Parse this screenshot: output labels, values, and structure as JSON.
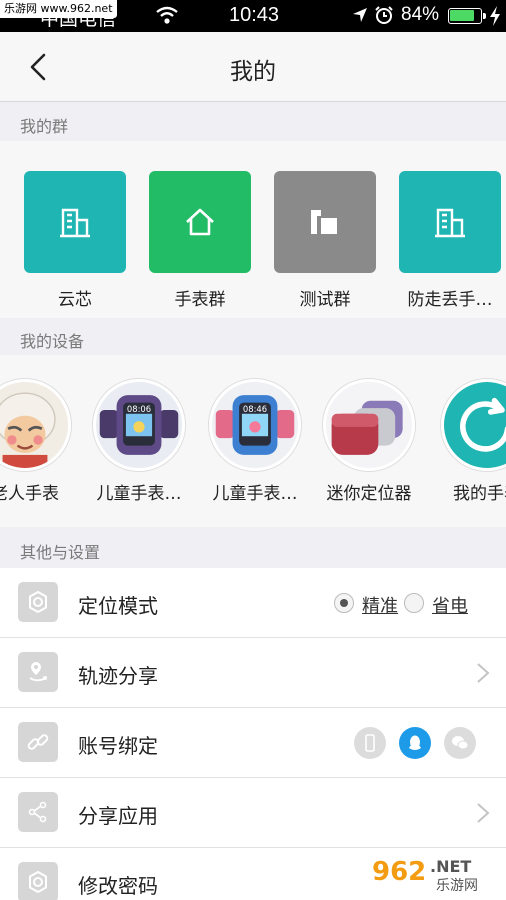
{
  "status_bar": {
    "watermark": "乐游网 www.962.net",
    "carrier": "中国电信",
    "time": "10:43",
    "battery_percent": "84%",
    "battery_level": 0.84
  },
  "nav": {
    "title": "我的"
  },
  "sections": {
    "groups": "我的群",
    "devices": "我的设备",
    "settings": "其他与设置"
  },
  "groups": [
    {
      "label": "云芯",
      "color": "#1fb5b3",
      "icon": "building-icon"
    },
    {
      "label": "手表群",
      "color": "#22bb66",
      "icon": "home-icon"
    },
    {
      "label": "测试群",
      "color": "#8a8a8a",
      "icon": "layout-icon"
    },
    {
      "label": "防走丢手…",
      "color": "#1fb5b3",
      "icon": "building-icon"
    }
  ],
  "devices": [
    {
      "label": "老人手表",
      "icon": "elder-avatar"
    },
    {
      "label": "儿童手表…",
      "icon": "kids-watch-purple",
      "screen_time": "08:06"
    },
    {
      "label": "儿童手表…",
      "icon": "kids-watch-blue",
      "screen_time": "08:46"
    },
    {
      "label": "迷你定位器",
      "icon": "mini-locator"
    },
    {
      "label": "我的手表",
      "icon": "add-device-icon"
    }
  ],
  "settings": {
    "location_mode": {
      "label": "定位模式",
      "options": [
        {
          "label": "精准",
          "checked": true
        },
        {
          "label": "省电",
          "checked": false
        }
      ]
    },
    "track_share": {
      "label": "轨迹分享"
    },
    "account_binding": {
      "label": "账号绑定",
      "accounts": [
        {
          "icon": "phone-icon",
          "bound": false,
          "color": "#dcdcdc"
        },
        {
          "icon": "qq-icon",
          "bound": true,
          "color": "#1e9be8"
        },
        {
          "icon": "wechat-icon",
          "bound": false,
          "color": "#dcdcdc"
        }
      ]
    },
    "share_app": {
      "label": "分享应用"
    },
    "change_password": {
      "label": "修改密码"
    }
  },
  "watermark": {
    "number": "962",
    "suffix": ".NET",
    "name": "乐游网"
  }
}
